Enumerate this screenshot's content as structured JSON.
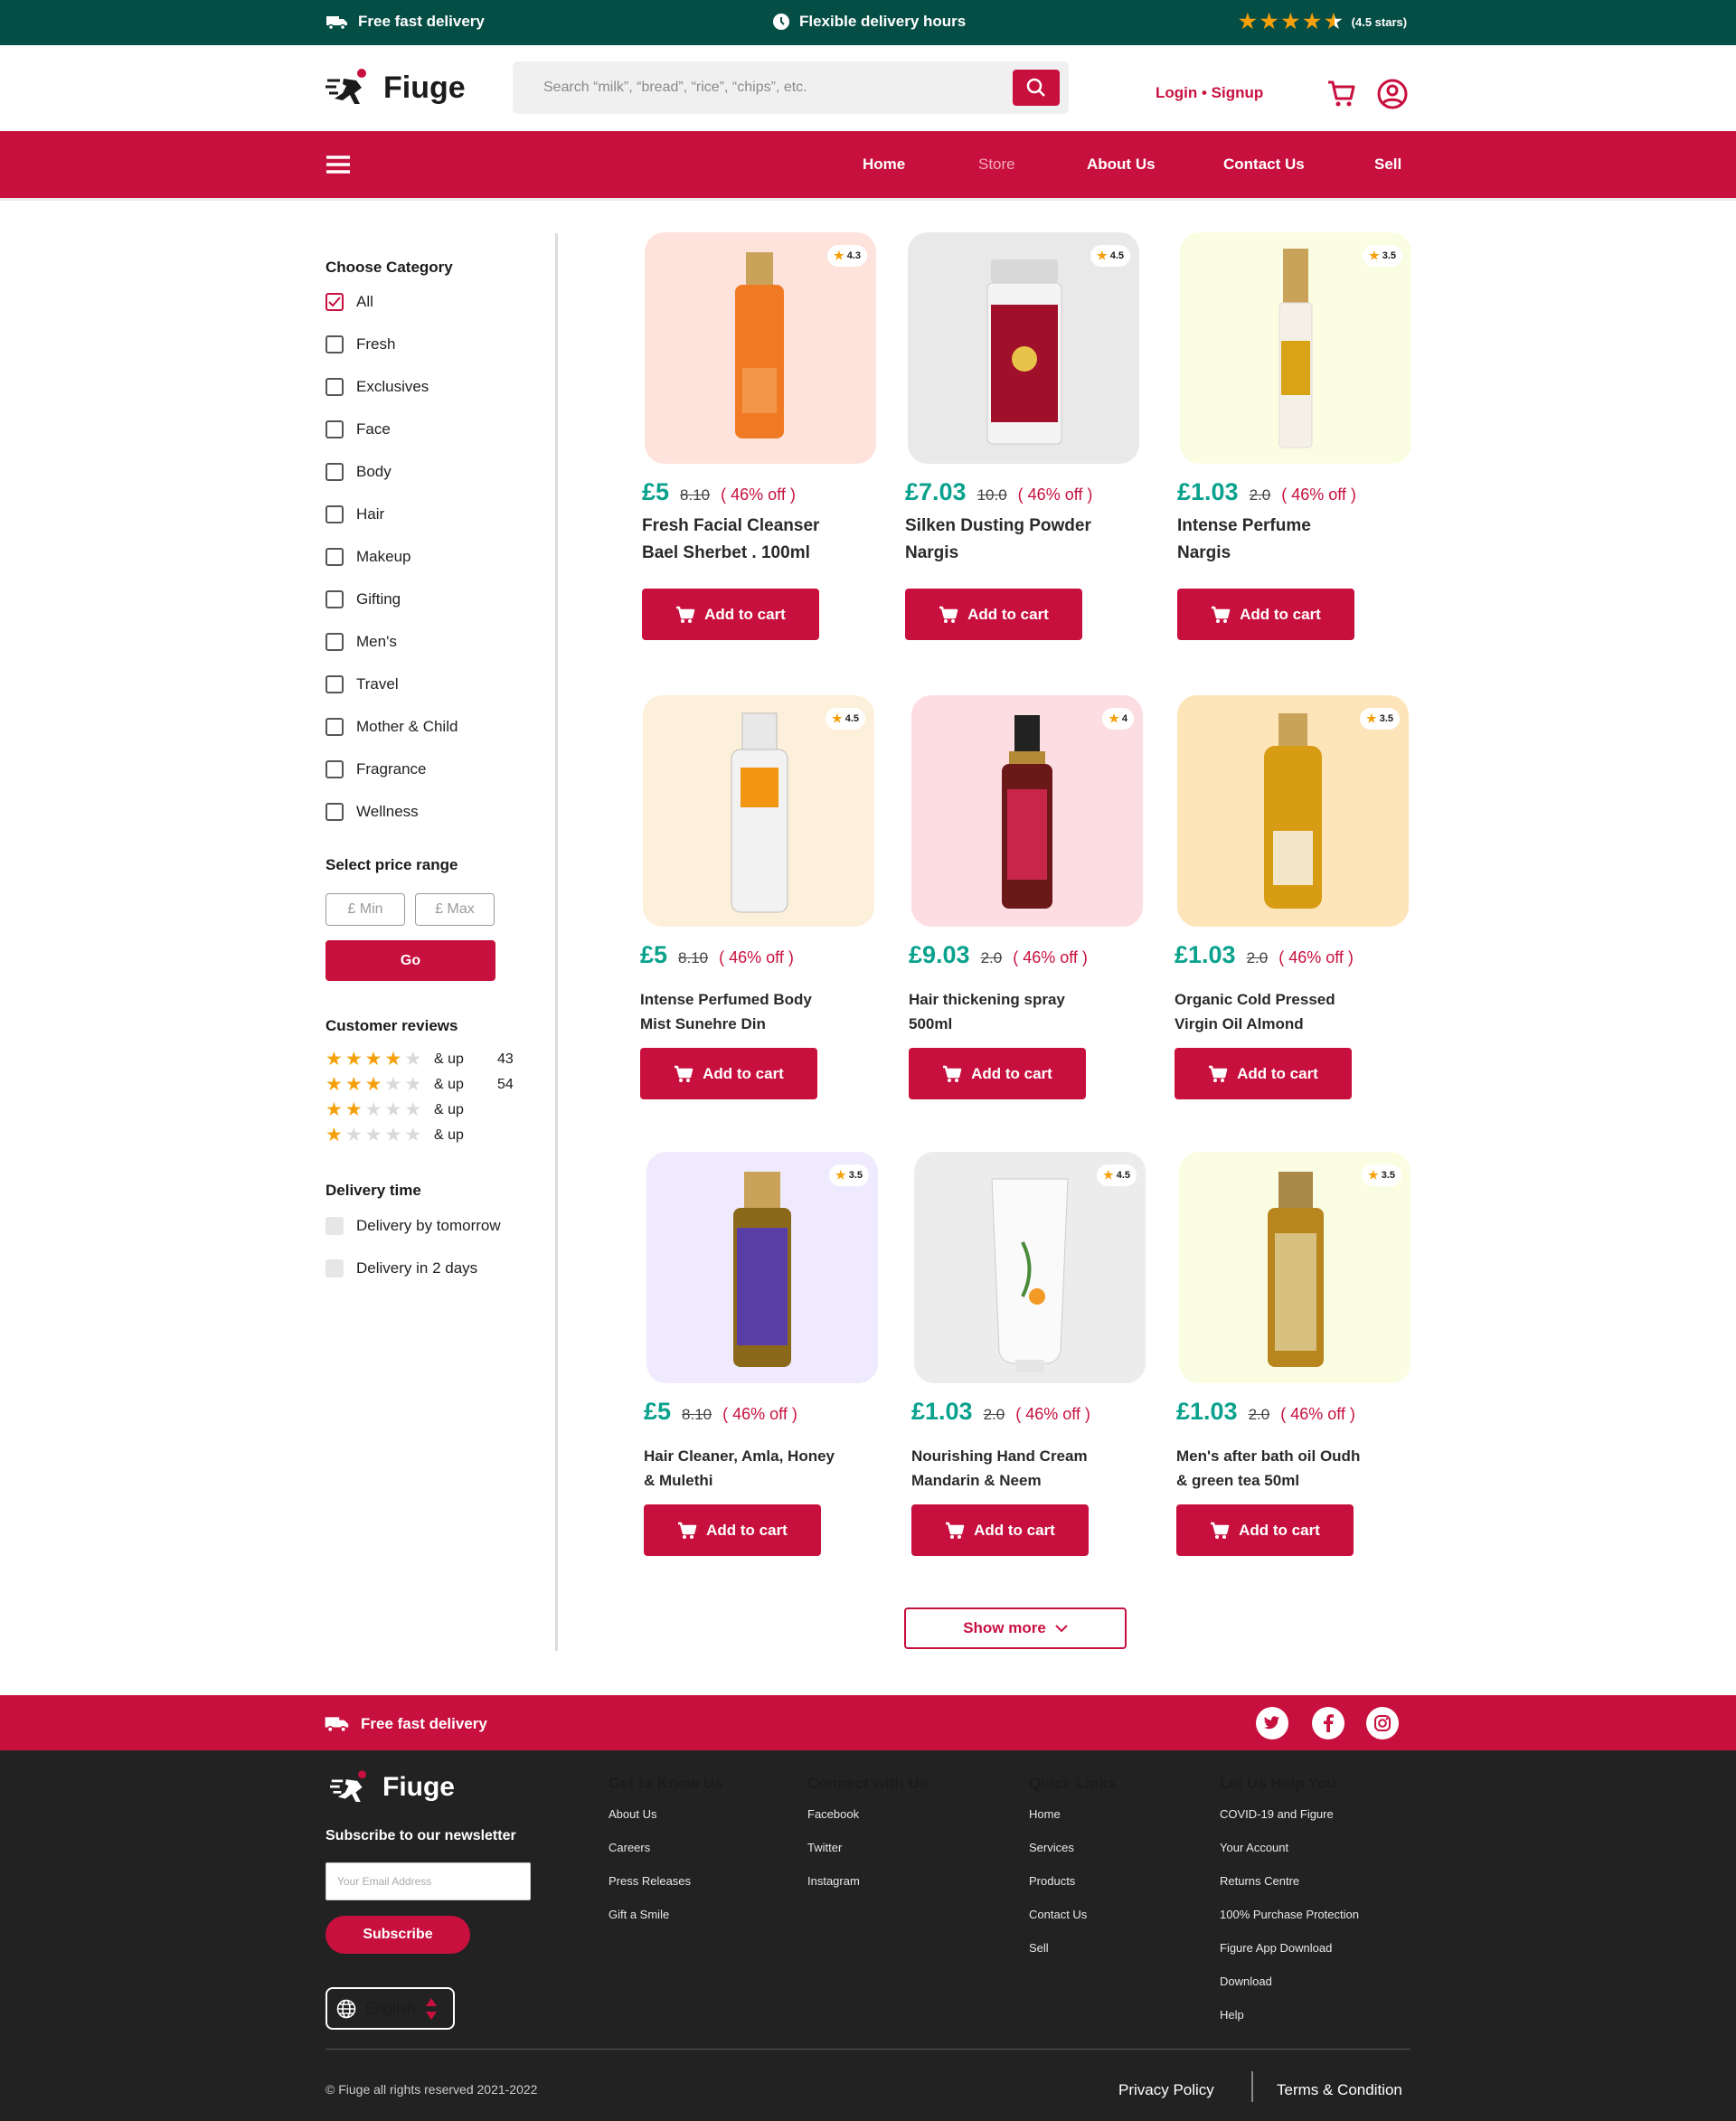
{
  "topbar": {
    "delivery": "Free fast delivery",
    "hours": "Flexible delivery hours",
    "rating": "(4.5 stars)"
  },
  "brand": {
    "name": "Fiuge"
  },
  "search": {
    "placeholder": "Search “milk”, “bread”, “rice”, “chips”, etc."
  },
  "header": {
    "login": "Login • Signup"
  },
  "nav": {
    "home": "Home",
    "store": "Store",
    "about": "About Us",
    "contact": "Contact Us",
    "sell": "Sell"
  },
  "sidebar": {
    "category_title": "Choose Category",
    "categories": [
      "All",
      "Fresh",
      "Exclusives",
      "Face",
      "Body",
      "Hair",
      "Makeup",
      "Gifting",
      "Men's",
      "Travel",
      "Mother & Child",
      "Fragrance",
      "Wellness"
    ],
    "price_title": "Select price range",
    "min_placeholder": "£ Min",
    "max_placeholder": "£ Max",
    "go": "Go",
    "reviews_title": "Customer reviews",
    "reviews": [
      {
        "stars": 4,
        "label": "& up",
        "count": "43"
      },
      {
        "stars": 3,
        "label": "& up",
        "count": "54"
      },
      {
        "stars": 2,
        "label": "& up",
        "count": ""
      },
      {
        "stars": 1,
        "label": "& up",
        "count": ""
      }
    ],
    "delivery_title": "Delivery time",
    "delivery_options": [
      "Delivery by tomorrow",
      "Delivery in 2 days"
    ]
  },
  "products": [
    {
      "rating": "4.3",
      "price": "£5",
      "old": "8.10",
      "off": "( 46% off )",
      "name1": "Fresh Facial Cleanser",
      "name2": "Bael Sherbet . 100ml",
      "button": "Add to cart",
      "bg": "#fde3dc"
    },
    {
      "rating": "4.5",
      "price": "£7.03",
      "old": "10.0",
      "off": "( 46% off )",
      "name1": "Silken Dusting Powder",
      "name2": "Nargis",
      "button": "Add to cart",
      "bg": "#e9e9e9"
    },
    {
      "rating": "3.5",
      "price": "£1.03",
      "old": "2.0",
      "off": "( 46% off )",
      "name1": "Intense Perfume",
      "name2": "Nargis",
      "button": "Add to cart",
      "bg": "#fafde2"
    },
    {
      "rating": "4.5",
      "price": "£5",
      "old": "8.10",
      "off": "( 46% off )",
      "name1": "Intense Perfumed Body",
      "name2": "Mist Sunehre Din",
      "button": "Add to cart",
      "bg": "#fdf0da"
    },
    {
      "rating": "4",
      "price": "£9.03",
      "old": "2.0",
      "off": "( 46% off )",
      "name1": "Hair thickening spray",
      "name2": "500ml",
      "button": "Add to cart",
      "bg": "#fcdde2"
    },
    {
      "rating": "3.5",
      "price": "£1.03",
      "old": "2.0",
      "off": "( 46% off )",
      "name1": "Organic Cold Pressed",
      "name2": "Virgin Oil Almond",
      "button": "Add to cart",
      "bg": "#fde4b9"
    },
    {
      "rating": "3.5",
      "price": "£5",
      "old": "8.10",
      "off": "( 46% off )",
      "name1": "Hair Cleaner, Amla, Honey",
      "name2": "& Mulethi",
      "button": "Add to cart",
      "bg": "#efeafd"
    },
    {
      "rating": "4.5",
      "price": "£1.03",
      "old": "2.0",
      "off": "( 46% off )",
      "name1": "Nourishing Hand Cream",
      "name2": "Mandarin & Neem",
      "button": "Add to cart",
      "bg": "#ececec"
    },
    {
      "rating": "3.5",
      "price": "£1.03",
      "old": "2.0",
      "off": "( 46% off )",
      "name1": "Men's after bath oil Oudh",
      "name2": "& green tea 50ml",
      "button": "Add to cart",
      "bg": "#fbfde2"
    }
  ],
  "show_more": "Show more",
  "footer": {
    "delivery": "Free fast delivery",
    "newsletter_title": "Subscribe to our newsletter",
    "email_placeholder": "Your Email Address",
    "subscribe": "Subscribe",
    "language": "English",
    "col1": {
      "title": "Get to Know Us",
      "links": [
        "About Us",
        "Careers",
        "Press Releases",
        "Gift a Smile"
      ]
    },
    "col2": {
      "title": "Connect with Us",
      "links": [
        "Facebook",
        "Twitter",
        "Instagram"
      ]
    },
    "col3": {
      "title": "Quick Links",
      "links": [
        "Home",
        "Services",
        "Products",
        "Contact Us",
        "Sell"
      ]
    },
    "col4": {
      "title": "Let Us Help You",
      "links": [
        "COVID-19 and Figure",
        "Your Account",
        "Returns Centre",
        "100% Purchase Protection",
        "Figure App Download",
        "Download",
        "Help"
      ]
    },
    "copyright": "© Fiuge all rights reserved 2021-2022",
    "privacy": "Privacy Policy",
    "terms": "Terms & Condition"
  },
  "colors": {
    "brand": "#c8103e",
    "topbar": "#054e45",
    "price": "#0aa28d",
    "star": "#f5a00a"
  }
}
